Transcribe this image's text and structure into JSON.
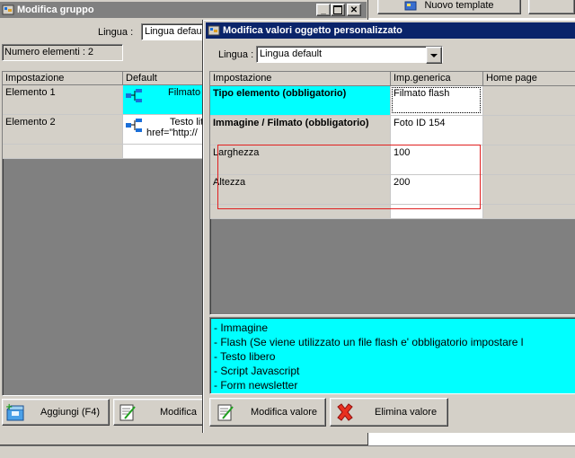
{
  "top_button": {
    "label": "Nuovo template"
  },
  "bg_window": {
    "title": "Modifica gruppo",
    "lingua_label": "Lingua :",
    "lingua_value": "Lingua defau",
    "count_label": "Numero elementi : 2",
    "columns": [
      "Impostazione",
      "Default"
    ],
    "rows": [
      {
        "name": "Elemento 1",
        "value": "Filmato"
      },
      {
        "name": "Elemento 2",
        "value1": "Testo lit",
        "value2": "href=\"http://"
      }
    ],
    "add_button": "Aggiungi (F4)",
    "modify_button": "Modifica"
  },
  "fg_window": {
    "title": "Modifica valori oggetto personalizzato",
    "lingua_label": "Lingua :",
    "lingua_value": "Lingua default",
    "columns": [
      "Impostazione",
      "Imp.generica",
      "Home page"
    ],
    "rows": [
      {
        "name": "Tipo elemento (obbligatorio)",
        "value": "Filmato flash"
      },
      {
        "name": "Immagine / Filmato (obbligatorio)",
        "value": "Foto ID 154"
      },
      {
        "name": "Larghezza",
        "value": "100"
      },
      {
        "name": "Altezza",
        "value": "200"
      }
    ],
    "list_items": [
      "- Immagine",
      "- Flash (Se viene utilizzato un file flash e' obbligatorio impostare l",
      "- Testo libero",
      "- Script Javascript",
      "- Form newsletter"
    ],
    "modify_button": "Modifica valore",
    "delete_button": "Elimina valore"
  },
  "colors": {
    "title_inactive": "#808080",
    "title_active": "#0a246a",
    "selection": "#00ffff",
    "highlight_box": "#e02020"
  }
}
